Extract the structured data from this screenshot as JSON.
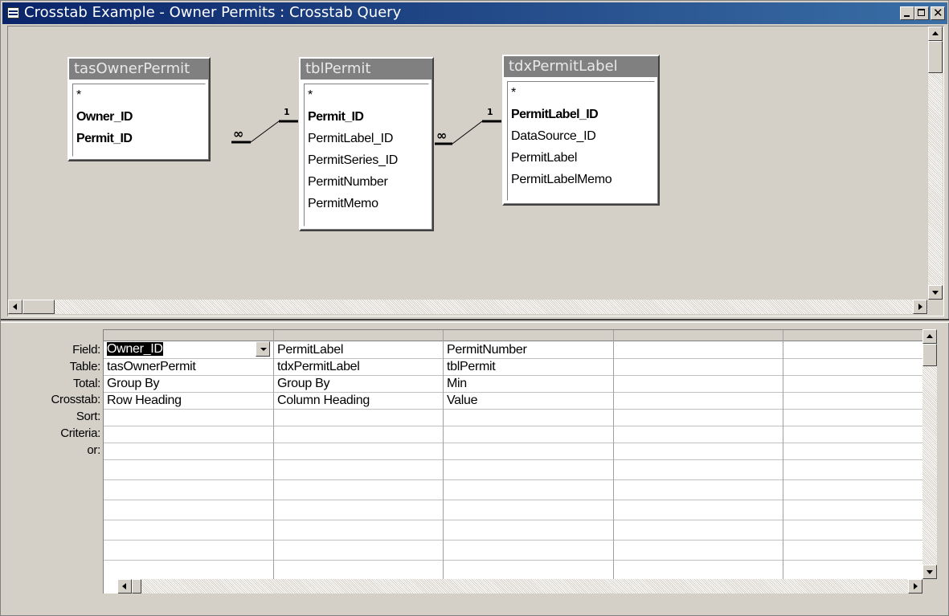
{
  "window": {
    "title": "Crosstab Example - Owner Permits : Crosstab Query",
    "buttons": {
      "minimize_icon": "minimize-icon",
      "maximize_icon": "maximize-icon",
      "close_icon": "close-icon"
    }
  },
  "tables": [
    {
      "name": "tasOwnerPermit",
      "fields": [
        {
          "label": "*",
          "pk": false
        },
        {
          "label": "Owner_ID",
          "pk": true
        },
        {
          "label": "Permit_ID",
          "pk": true
        }
      ]
    },
    {
      "name": "tblPermit",
      "fields": [
        {
          "label": "*",
          "pk": false
        },
        {
          "label": "Permit_ID",
          "pk": true
        },
        {
          "label": "PermitLabel_ID",
          "pk": false
        },
        {
          "label": "PermitSeries_ID",
          "pk": false
        },
        {
          "label": "PermitNumber",
          "pk": false
        },
        {
          "label": "PermitMemo",
          "pk": false
        }
      ]
    },
    {
      "name": "tdxPermitLabel",
      "fields": [
        {
          "label": "*",
          "pk": false
        },
        {
          "label": "PermitLabel_ID",
          "pk": true
        },
        {
          "label": "DataSource_ID",
          "pk": false
        },
        {
          "label": "PermitLabel",
          "pk": false
        },
        {
          "label": "PermitLabelMemo",
          "pk": false
        }
      ]
    }
  ],
  "relationships": [
    {
      "many_label": "∞",
      "one_label": "1"
    },
    {
      "many_label": "∞",
      "one_label": "1"
    }
  ],
  "grid": {
    "row_labels": [
      "Field:",
      "Table:",
      "Total:",
      "Crosstab:",
      "Sort:",
      "Criteria:",
      "or:"
    ],
    "columns": [
      {
        "field": "Owner_ID",
        "table": "tasOwnerPermit",
        "total": "Group By",
        "crosstab": "Row Heading"
      },
      {
        "field": "PermitLabel",
        "table": "tdxPermitLabel",
        "total": "Group By",
        "crosstab": "Column Heading"
      },
      {
        "field": "PermitNumber",
        "table": "tblPermit",
        "total": "Min",
        "crosstab": "Value"
      },
      {
        "field": "",
        "table": "",
        "total": "",
        "crosstab": ""
      },
      {
        "field": "",
        "table": "",
        "total": "",
        "crosstab": ""
      }
    ]
  },
  "colors": {
    "title_start": "#0a246a",
    "title_end": "#3a6ea5",
    "face": "#d4d0c8",
    "table_header": "#808080"
  }
}
